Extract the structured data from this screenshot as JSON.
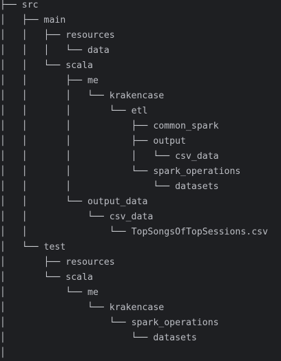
{
  "window": {
    "background": "#1e1f22",
    "text_color": "#bcbec4"
  },
  "tree_lines": [
    {
      "prefix": "├── ",
      "name": "src"
    },
    {
      "prefix": "│   ├── ",
      "name": "main"
    },
    {
      "prefix": "│   │   ├── ",
      "name": "resources"
    },
    {
      "prefix": "│   │   │   └── ",
      "name": "data"
    },
    {
      "prefix": "│   │   └── ",
      "name": "scala"
    },
    {
      "prefix": "│   │       ├── ",
      "name": "me"
    },
    {
      "prefix": "│   │       │   └── ",
      "name": "krakencase"
    },
    {
      "prefix": "│   │       │       └── ",
      "name": "etl"
    },
    {
      "prefix": "│   │       │           ├── ",
      "name": "common_spark"
    },
    {
      "prefix": "│   │       │           ├── ",
      "name": "output"
    },
    {
      "prefix": "│   │       │           │   └── ",
      "name": "csv_data"
    },
    {
      "prefix": "│   │       │           └── ",
      "name": "spark_operations"
    },
    {
      "prefix": "│   │       │               └── ",
      "name": "datasets"
    },
    {
      "prefix": "│   │       └── ",
      "name": "output_data"
    },
    {
      "prefix": "│   │           └── ",
      "name": "csv_data"
    },
    {
      "prefix": "│   │               └── ",
      "name": "TopSongsOfTopSessions.csv"
    },
    {
      "prefix": "│   └── ",
      "name": "test"
    },
    {
      "prefix": "│       ├── ",
      "name": "resources"
    },
    {
      "prefix": "│       └── ",
      "name": "scala"
    },
    {
      "prefix": "│           └── ",
      "name": "me"
    },
    {
      "prefix": "│               └── ",
      "name": "krakencase"
    },
    {
      "prefix": "│                   └── ",
      "name": "spark_operations"
    },
    {
      "prefix": "│                       └── ",
      "name": "datasets"
    },
    {
      "prefix": "│",
      "name": ""
    }
  ]
}
